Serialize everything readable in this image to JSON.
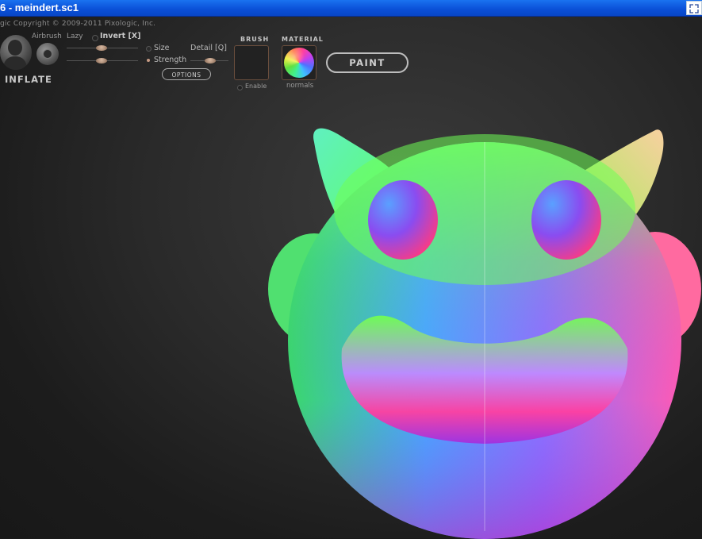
{
  "window": {
    "title": "6 - meindert.sc1"
  },
  "toolbar": {
    "copyright": "gic  Copyright © 2009-2011 Pixologic, Inc.",
    "airbrush_label": "Airbrush",
    "lazy_label": "Lazy",
    "invert_label": "Invert [X]",
    "size_label": "Size",
    "strength_label": "Strength",
    "detail_label": "Detail [Q]",
    "options_label": "OPTIONS",
    "tool_name": "INFLATE",
    "brush_header": "BRUSH",
    "brush_enable": "Enable",
    "material_header": "MATERIAL",
    "material_name": "normals",
    "paint_label": "PAINT"
  },
  "colors": {
    "titlebar": "#0a4fd6",
    "background": "#1c1c1c",
    "accent_knob": "#c59a84",
    "button_outline": "#bdbdbd"
  },
  "icons": {
    "tool": "inflate-brush-icon",
    "restore": "restore-window-icon"
  }
}
